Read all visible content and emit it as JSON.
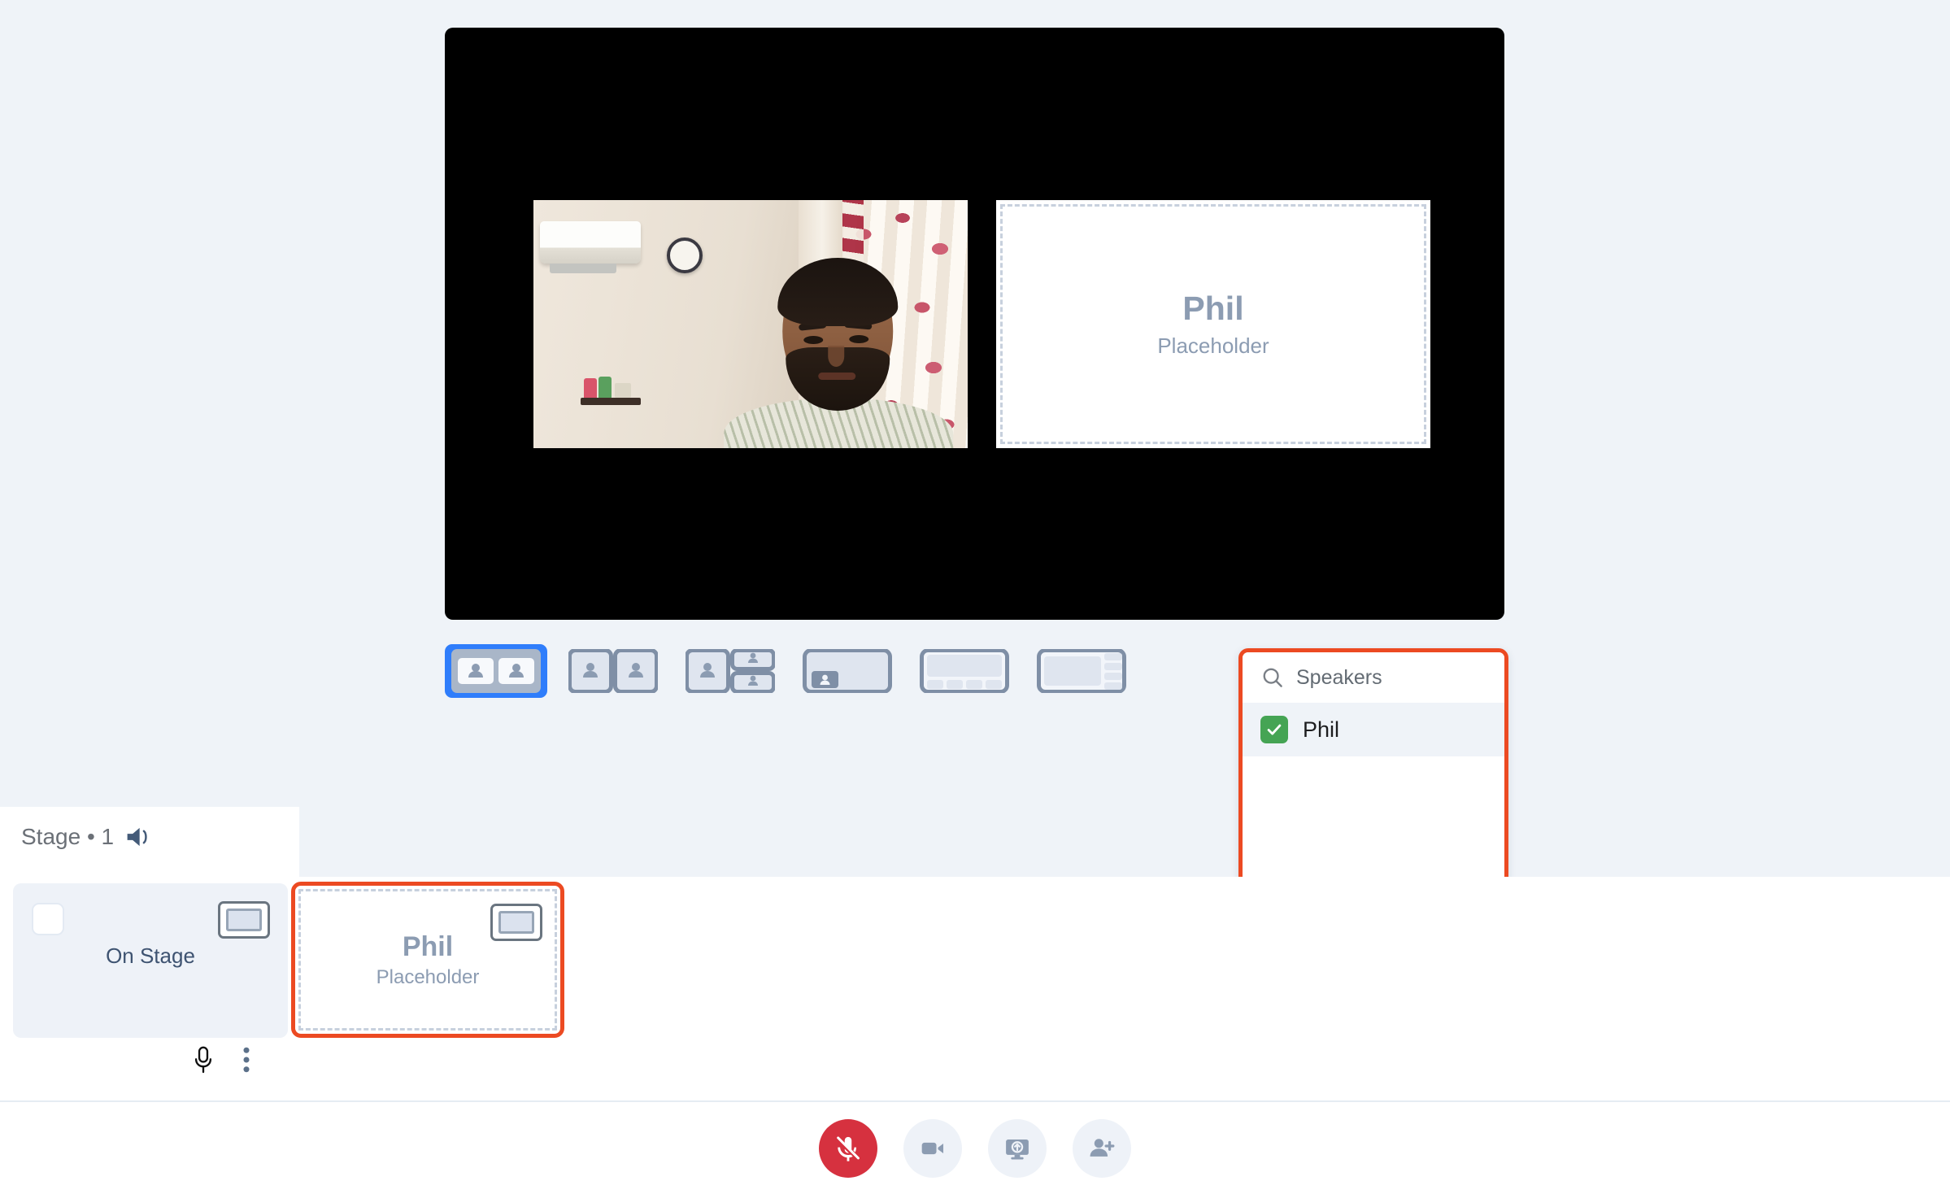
{
  "stage": {
    "title": "Stage • 1",
    "speaker_icon": "speaker-volume-icon",
    "on_stage_label": "On Stage",
    "mic_icon": "microphone-icon",
    "more_icon": "more-vertical-icon"
  },
  "main_video": {
    "participant_name": "Phil",
    "placeholder_label": "Placeholder",
    "webcam_alt": "webcam-video-feed"
  },
  "strip_card": {
    "name": "Phil",
    "placeholder_label": "Placeholder",
    "screen_icon": "screen-share-badge-icon"
  },
  "layouts": [
    {
      "name": "layout-side-by-side",
      "selected": true
    },
    {
      "name": "layout-split-two",
      "selected": false
    },
    {
      "name": "layout-one-plus-two",
      "selected": false
    },
    {
      "name": "layout-picture-in-picture",
      "selected": false
    },
    {
      "name": "layout-main-with-filmstrip",
      "selected": false
    },
    {
      "name": "layout-main-with-sidebar",
      "selected": false
    }
  ],
  "speakers_panel": {
    "search_placeholder": "Speakers",
    "search_icon": "search-icon",
    "highlight_color": "#ec4a22",
    "items": [
      {
        "label": "Phil",
        "checked": true,
        "check_color": "#45a454"
      }
    ]
  },
  "toolbar": {
    "buttons": [
      {
        "name": "microphone-muted-button",
        "icon": "mic-off-icon",
        "state": "muted",
        "color": "#d6313f"
      },
      {
        "name": "camera-button",
        "icon": "video-camera-icon",
        "state": "default",
        "color": "#8c9cb2"
      },
      {
        "name": "share-screen-button",
        "icon": "screen-share-icon",
        "state": "default",
        "color": "#8c9cb2"
      },
      {
        "name": "add-participant-button",
        "icon": "person-add-icon",
        "state": "default",
        "color": "#8c9cb2"
      }
    ]
  },
  "colors": {
    "page_background": "#eff3f8",
    "panel_background": "#ffffff",
    "accent_selected": "#2f7dfb",
    "highlight_ring": "#ec4a22",
    "placeholder_text": "#8c9cb2"
  }
}
